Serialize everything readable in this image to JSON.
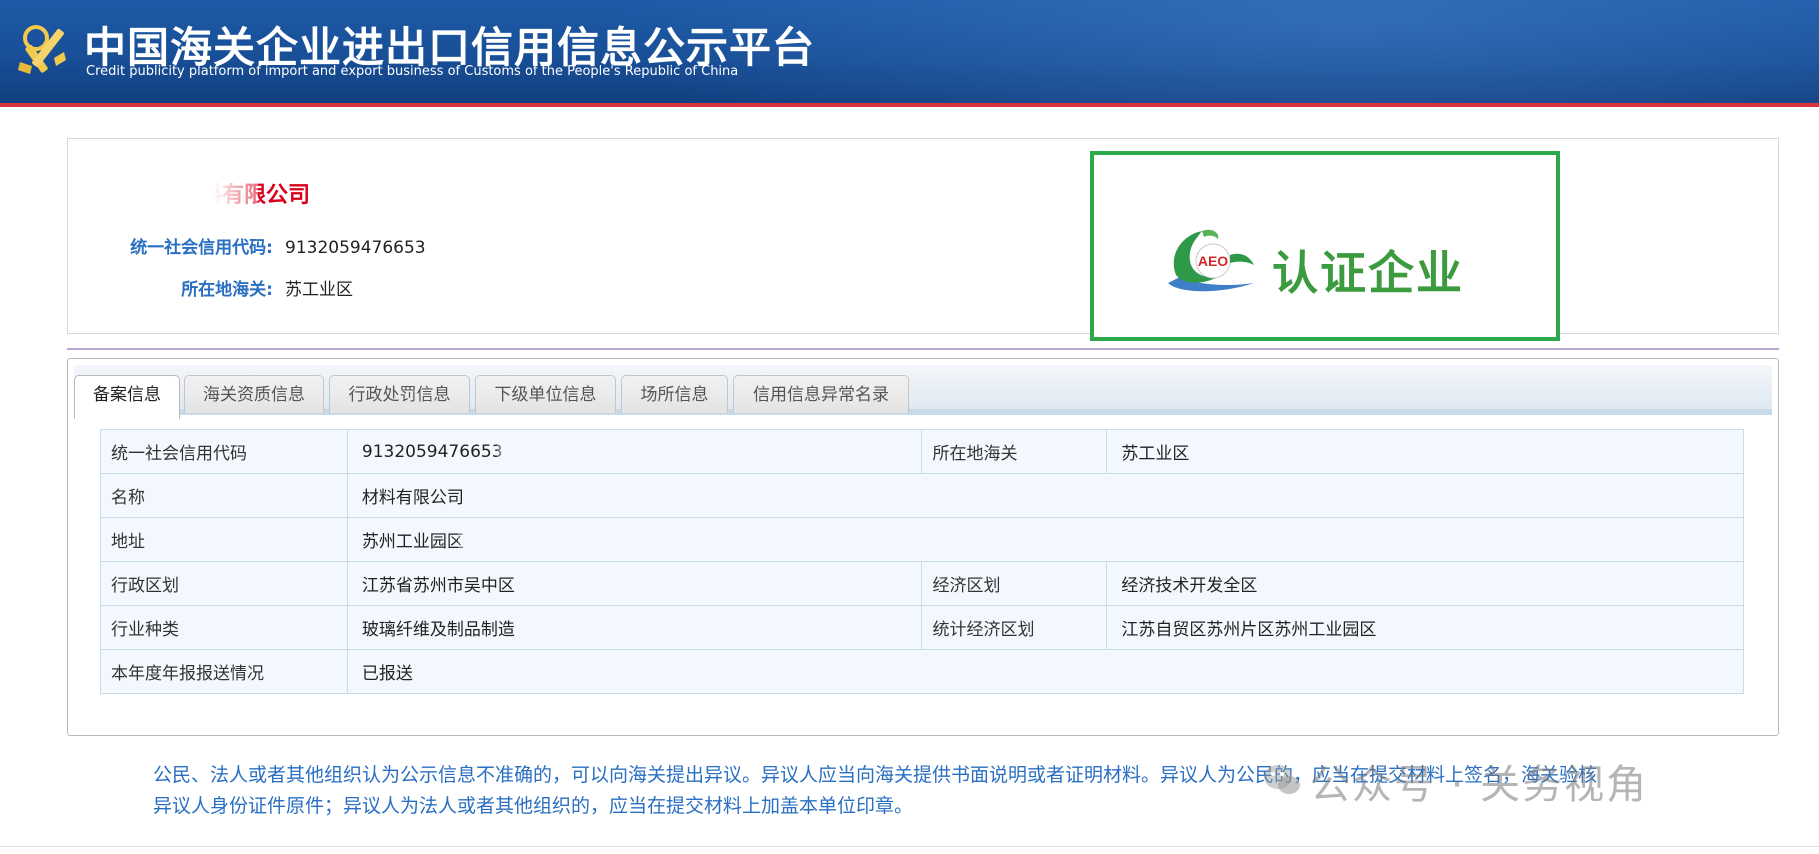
{
  "header": {
    "title_cn": "中国海关企业进出口信用信息公示平台",
    "title_en": "Credit publicity platform of import and export business of Customs of the People's Republic of China"
  },
  "company": {
    "name": "材料有限公司",
    "credit_code_label": "统一社会信用代码:",
    "credit_code_value": "9132059476653",
    "customs_label": "所在地海关:",
    "customs_value": "苏工业区"
  },
  "aeo": {
    "badge_text": "AEO",
    "label": "认证企业"
  },
  "tabs": [
    {
      "label": "备案信息",
      "active": true
    },
    {
      "label": "海关资质信息",
      "active": false
    },
    {
      "label": "行政处罚信息",
      "active": false
    },
    {
      "label": "下级单位信息",
      "active": false
    },
    {
      "label": "场所信息",
      "active": false
    },
    {
      "label": "信用信息异常名录",
      "active": false
    }
  ],
  "record": {
    "credit_code_key": "统一社会信用代码",
    "credit_code_val": "9132059476653",
    "customs_key": "所在地海关",
    "customs_val": "苏工业区",
    "name_key": "名称",
    "name_val": "材料有限公司",
    "address_key": "地址",
    "address_val": "苏州工业园区",
    "admin_region_key": "行政区划",
    "admin_region_val": "江苏省苏州市吴中区",
    "econ_region_key": "经济区划",
    "econ_region_val": "经济技术开发全区",
    "industry_key": "行业种类",
    "industry_val": "玻璃纤维及制品制造",
    "stat_region_key": "统计经济区划",
    "stat_region_val": "江苏自贸区苏州片区苏州工业园区",
    "annual_report_key": "本年度年报报送情况",
    "annual_report_val": "已报送"
  },
  "note": {
    "line1": "公民、法人或者其他组织认为公示信息不准确的，可以向海关提出异议。异议人应当向海关提供书面说明或者证明材料。异议人为公民的，应当在提交材料上签名，海关验核",
    "line2": "异议人身份证件原件；异议人为法人或者其他组织的，应当在提交材料上加盖本单位印章。"
  },
  "watermark": {
    "text": "公众号 · 关务视角"
  },
  "colors": {
    "header_blue": "#184f97",
    "header_red_line": "#d9333c",
    "label_blue": "#2a6fc2",
    "company_red": "#d9001b",
    "aeo_green": "#2ca94a"
  }
}
